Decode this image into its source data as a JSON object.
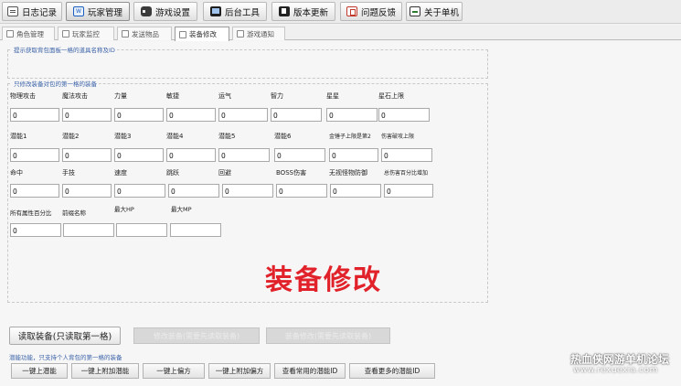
{
  "toolbar": {
    "items": [
      {
        "label": "日志记录",
        "icon": "log-icon"
      },
      {
        "label": "玩家管理",
        "icon": "player-icon"
      },
      {
        "label": "游戏设置",
        "icon": "gamepad-icon"
      },
      {
        "label": "后台工具",
        "icon": "monitor-icon"
      },
      {
        "label": "版本更新",
        "icon": "update-icon"
      },
      {
        "label": "问题反馈",
        "icon": "feedback-icon"
      },
      {
        "label": "关于单机",
        "icon": "about-icon"
      }
    ],
    "active_index": 1
  },
  "subtabs": {
    "items": [
      "角色管理",
      "玩家监控",
      "发送物品",
      "装备修改",
      "游戏通知"
    ],
    "active_index": 3
  },
  "sections": {
    "id_group_title": "提示获取背包面板一格的道具名称及ID",
    "stats_group_title": "只修改装备对包的第一格的装备"
  },
  "fields": {
    "row1": [
      {
        "label": "物理攻击",
        "value": "0"
      },
      {
        "label": "魔法攻击",
        "value": "0"
      },
      {
        "label": "力量",
        "value": "0"
      },
      {
        "label": "敏捷",
        "value": "0"
      },
      {
        "label": "运气",
        "value": "0"
      },
      {
        "label": "智力",
        "value": "0"
      },
      {
        "label": "星星",
        "value": "0"
      },
      {
        "label": "星石上限",
        "value": "0"
      }
    ],
    "row2": [
      {
        "label": "潜能1",
        "value": "0"
      },
      {
        "label": "潜能2",
        "value": "0"
      },
      {
        "label": "潜能3",
        "value": "0"
      },
      {
        "label": "潜能4",
        "value": "0"
      },
      {
        "label": "潜能5",
        "value": "0"
      },
      {
        "label": "潜能6",
        "value": "0"
      },
      {
        "label": "金锤子上限是第2",
        "value": "0"
      },
      {
        "label": "伤害破攻上限",
        "value": "0"
      }
    ],
    "row3": [
      {
        "label": "命中",
        "value": "0"
      },
      {
        "label": "手技",
        "value": "0"
      },
      {
        "label": "速度",
        "value": "0"
      },
      {
        "label": "跳跃",
        "value": "0"
      },
      {
        "label": "回避",
        "value": "0"
      },
      {
        "label": "BOSS伤害",
        "value": "0"
      },
      {
        "label": "无视怪物防御",
        "value": "0"
      },
      {
        "label": "总伤害百分比增加",
        "value": "0"
      }
    ],
    "row4": [
      {
        "label": "所有属性百分比",
        "value": "0"
      },
      {
        "label": "前缀名称",
        "value": ""
      },
      {
        "label": "最大HP",
        "value": ""
      },
      {
        "label": "最大MP",
        "value": ""
      }
    ]
  },
  "overlay_text": "装备修改",
  "actions": {
    "read_equipment": "读取装备(只读取第一格)",
    "disabled_1": "修改装备(需要先读取装备)",
    "disabled_2": "装备修改(需要先读取装备)"
  },
  "note": "潜能功能，只支持个人背包的第一格的装备",
  "bottom_buttons": [
    "一键上潜能",
    "一键上附加潜能",
    "一键上偏方",
    "一键上附加偏方",
    "查看常用的潜能ID",
    "查看更多的潜能ID"
  ],
  "watermark": {
    "line1": "热血侠网游单机论坛",
    "line2": "www.rexuexia.com"
  }
}
